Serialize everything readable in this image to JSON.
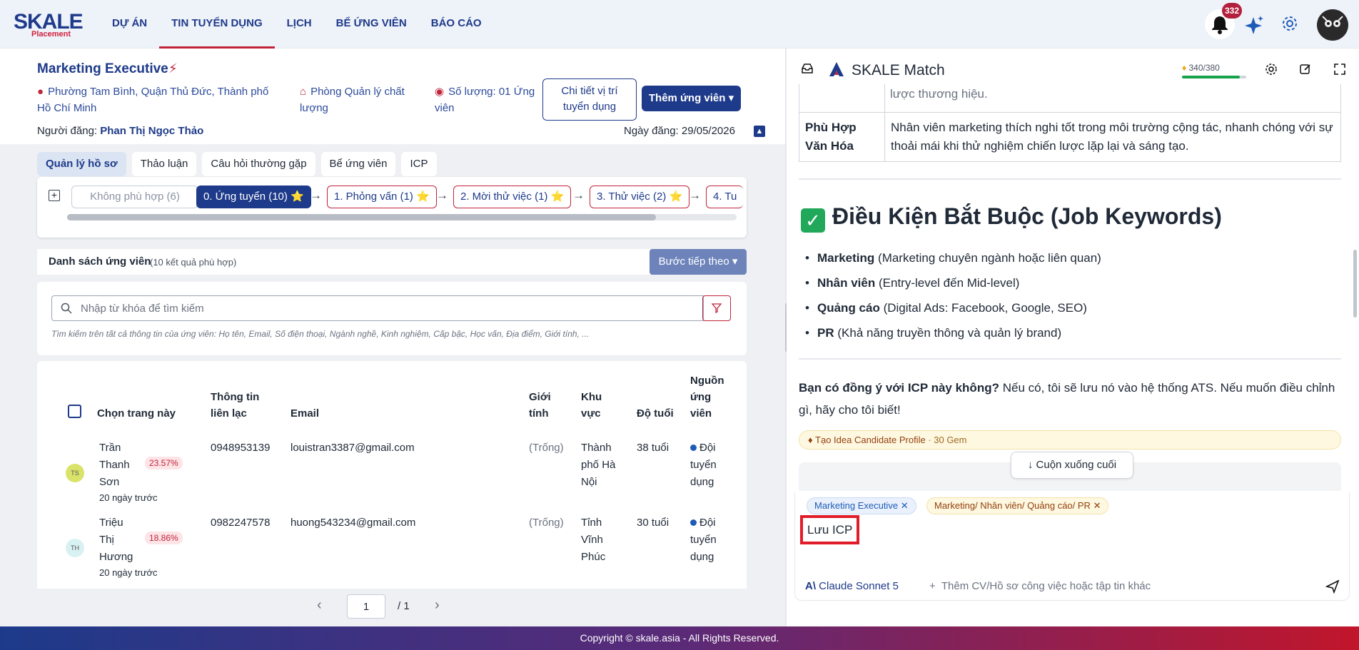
{
  "nav": {
    "logo_main": "SKALE",
    "logo_sub": "Placement",
    "items": [
      "DỰ ÁN",
      "TIN TUYỂN DỤNG",
      "LỊCH",
      "BỂ ỨNG VIÊN",
      "BÁO CÁO"
    ],
    "active_index": 1,
    "notification_count": "332"
  },
  "job": {
    "title": "Marketing Executive",
    "location_line1": "Phường Tam Bình, Quận Thủ Đức, Thành phố",
    "location_line2": "Hồ Chí Minh",
    "department_line1": "Phòng Quản lý chất",
    "department_line2": "lượng",
    "quantity_line1": "Số lượng: 01 Ứng",
    "quantity_line2": "viên",
    "detail_btn_line1": "Chi tiết vị trí",
    "detail_btn_line2": "tuyển dụng",
    "add_candidate_btn": "Thêm ứng viên ▾",
    "poster_label": "Người đăng:",
    "poster_name": "Phan Thị Ngọc Thảo",
    "post_date": "Ngày đăng: 29/05/2026"
  },
  "tabs": [
    "Quản lý hồ sơ",
    "Thảo luận",
    "Câu hỏi thường gặp",
    "Bể ứng viên",
    "ICP"
  ],
  "stages": {
    "not_fit": "Không phù hợp (6)",
    "items": [
      "0. Ứng tuyển (10) ⭐",
      "1. Phỏng vấn (1) ⭐",
      "2. Mời thử việc (1) ⭐",
      "3. Thử việc (2) ⭐",
      "4. Tu"
    ]
  },
  "list": {
    "title": "Danh sách ứng viên",
    "count": "(10 kết quả phù hợp)",
    "next_btn": "Bước tiếp theo ▾",
    "search_placeholder": "Nhập từ khóa để tìm kiếm",
    "search_hint": "Tìm kiếm trên tất cả thông tin của ứng viên: Họ tên, Email, Số điện thoại, Ngành nghề, Kinh nghiệm, Cấp bậc, Học vấn, Địa điểm, Giới tính, ..."
  },
  "table": {
    "headers": {
      "select": "Chọn trang này",
      "contact_1": "Thông tin",
      "contact_2": "liên lạc",
      "email": "Email",
      "gender_1": "Giới",
      "gender_2": "tính",
      "area_1": "Khu",
      "area_2": "vực",
      "age": "Độ tuổi",
      "source_1": "Nguồn",
      "source_2": "ứng",
      "source_3": "viên"
    },
    "rows": [
      {
        "initials": "TS",
        "name_1": "Trần",
        "name_2": "Thanh",
        "name_3": "Sơn",
        "match": "23.57%",
        "ago": "20 ngày trước",
        "phone": "0948953139",
        "email": "louistran3387@gmail.com",
        "gender": "(Trống)",
        "area_1": "Thành",
        "area_2": "phố Hà",
        "area_3": "Nội",
        "age": "38 tuổi",
        "source_1": "Đội",
        "source_2": "tuyển",
        "source_3": "dụng",
        "avatar_color": "#d9e36a"
      },
      {
        "initials": "TH",
        "name_1": "Triệu",
        "name_2": "Thị",
        "name_3": "Hương",
        "match": "18.86%",
        "ago": "20 ngày trước",
        "phone": "0982247578",
        "email": "huong543234@gmail.com",
        "gender": "(Trống)",
        "area_1": "Tỉnh",
        "area_2": "Vĩnh",
        "area_3": "Phúc",
        "age": "30 tuổi",
        "source_1": "Đội",
        "source_2": "tuyển",
        "source_3": "dụng",
        "avatar_color": "#d8f1f3"
      }
    ]
  },
  "pager": {
    "current": "1",
    "total": "/ 1"
  },
  "panel": {
    "title": "SKALE Match",
    "gems": "340/380",
    "gem_fraction": 0.895,
    "prev_text": "lược thương hiệu.",
    "culture_label_1": "Phù Hợp",
    "culture_label_2": "Văn Hóa",
    "culture_text": "Nhân viên marketing thích nghi tốt trong môi trường cộng tác, nhanh chóng với sự thoải mái khi thử nghiệm chiến lược lặp lại và sáng tạo.",
    "heading": "Điều Kiện Bắt Buộc (Job Keywords)",
    "keywords": [
      {
        "term": "Marketing",
        "desc": "(Marketing chuyên ngành hoặc liên quan)"
      },
      {
        "term": "Nhân viên",
        "desc": "(Entry-level đến Mid-level)"
      },
      {
        "term": "Quảng cáo",
        "desc": "(Digital Ads: Facebook, Google, SEO)"
      },
      {
        "term": "PR",
        "desc": "(Khả năng truyền thông và quản lý brand)"
      }
    ],
    "question_bold": "Bạn có đồng ý với ICP này không?",
    "question_rest": " Nếu có, tôi sẽ lưu nó vào hệ thống ATS. Nếu muốn điều chỉnh gì, hãy cho tôi biết!",
    "idea_label": "Tạo Idea Candidate Profile",
    "idea_cost": "· 30 Gem",
    "scroll_down": "Cuộn xuống cuối",
    "chip_1": "Marketing Executive",
    "chip_2": "Marketing/ Nhân viên/ Quảng cáo/ PR",
    "typed": "Lưu ICP",
    "model": "Claude Sonnet 5",
    "attach": "Thêm CV/Hồ sơ công việc hoặc tập tin khác"
  },
  "footer": "Copyright © skale.asia - All Rights Reserved."
}
